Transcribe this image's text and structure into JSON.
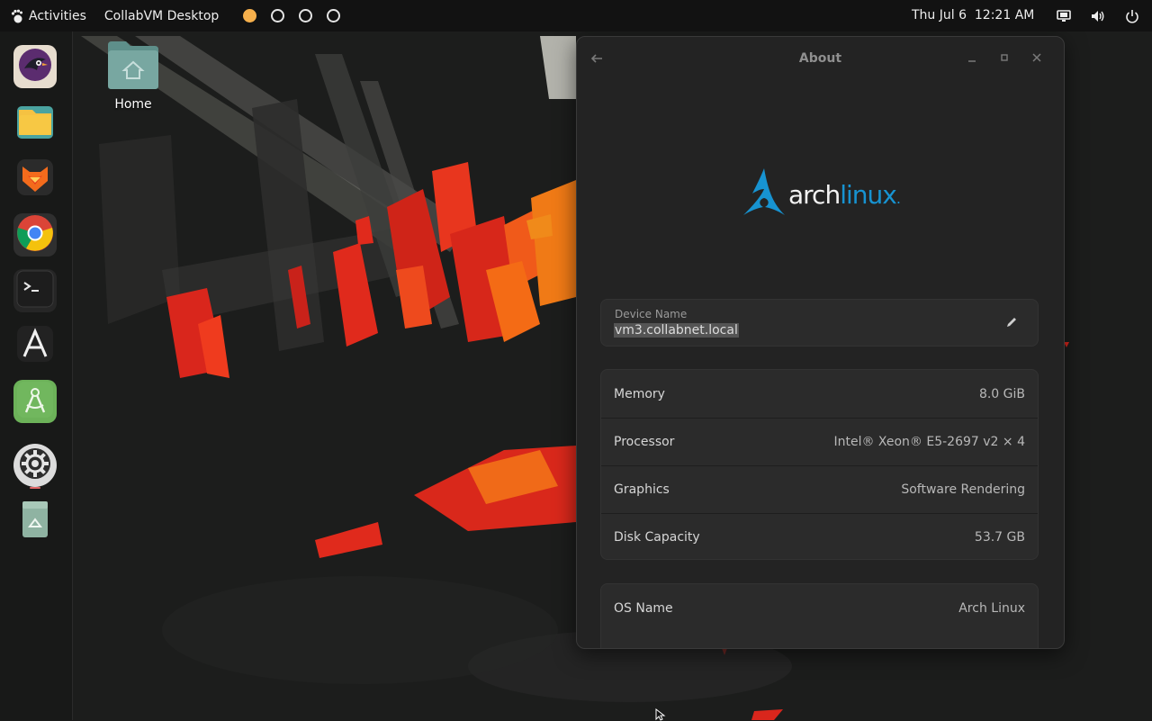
{
  "topbar": {
    "activities_label": "Activities",
    "app_name": "CollabVM Desktop",
    "clock": "Thu Jul 6  12:21 AM",
    "workspaces": [
      {
        "active": true
      },
      {
        "active": false
      },
      {
        "active": false
      },
      {
        "active": false
      }
    ],
    "tray_icons": [
      "display-icon",
      "volume-icon",
      "power-icon"
    ]
  },
  "dock": {
    "items": [
      {
        "name": "dock-app-bird",
        "icon": "bird-logo-icon"
      },
      {
        "name": "dock-files",
        "icon": "files-icon"
      },
      {
        "name": "dock-librewolf",
        "icon": "fox-browser-icon"
      },
      {
        "name": "dock-chrome",
        "icon": "chrome-icon"
      },
      {
        "name": "dock-terminal",
        "icon": "terminal-icon"
      },
      {
        "name": "dock-fonts",
        "icon": "font-a-icon"
      },
      {
        "name": "dock-android-studio",
        "icon": "compass-icon"
      },
      {
        "name": "dock-settings",
        "icon": "gear-icon"
      },
      {
        "name": "dock-trash",
        "icon": "recycle-icon"
      }
    ]
  },
  "desktop": {
    "home_label": "Home"
  },
  "window": {
    "title": "About",
    "logo_text_1": "arch",
    "logo_text_2": "linux",
    "logo_dot": ".",
    "device_label": "Device Name",
    "device_value": "vm3.collabnet.local",
    "hardware": [
      {
        "key": "Memory",
        "value": "8.0 GiB"
      },
      {
        "key": "Processor",
        "value": "Intel® Xeon® E5-2697 v2 × 4"
      },
      {
        "key": "Graphics",
        "value": "Software Rendering"
      },
      {
        "key": "Disk Capacity",
        "value": "53.7 GB"
      }
    ],
    "os": [
      {
        "key": "OS Name",
        "value": "Arch Linux"
      }
    ]
  },
  "colors": {
    "accent_workspace": "#f6b04c",
    "arch_blue": "#1793d1",
    "window_bg": "#232323",
    "card_bg": "#2b2b2b"
  }
}
